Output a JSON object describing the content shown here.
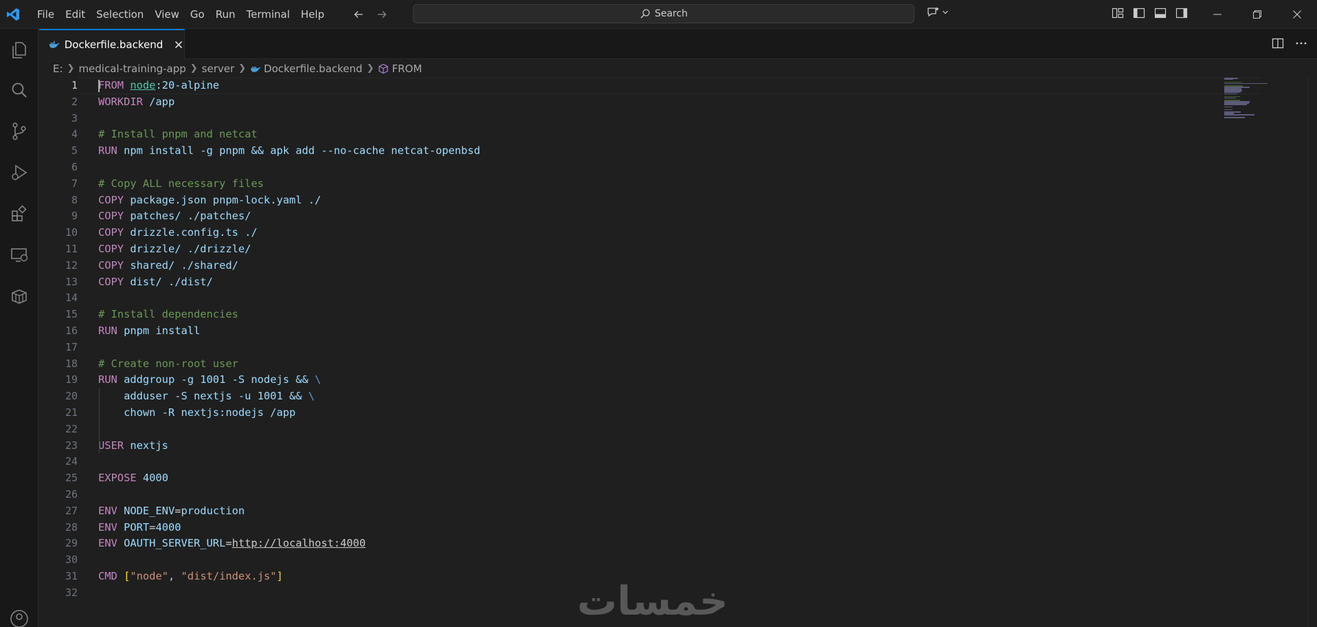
{
  "menu": [
    "File",
    "Edit",
    "Selection",
    "View",
    "Go",
    "Run",
    "Terminal",
    "Help"
  ],
  "search": {
    "label": "Search"
  },
  "tab": {
    "label": "Dockerfile.backend"
  },
  "breadcrumb": {
    "drive": "E:",
    "folder1": "medical-training-app",
    "folder2": "server",
    "file": "Dockerfile.backend",
    "symbol": "FROM"
  },
  "editor": {
    "active_line": 1,
    "line_numbers": [
      "1",
      "2",
      "3",
      "4",
      "5",
      "6",
      "7",
      "8",
      "9",
      "10",
      "11",
      "12",
      "13",
      "14",
      "15",
      "16",
      "17",
      "18",
      "19",
      "20",
      "21",
      "22",
      "23",
      "24",
      "25",
      "26",
      "27",
      "28",
      "29",
      "30",
      "31",
      "32"
    ],
    "lines": [
      [
        {
          "t": "FROM",
          "c": "kw"
        },
        {
          "t": " ",
          "c": "plain"
        },
        {
          "t": "node",
          "c": "type"
        },
        {
          "t": ":20-alpine",
          "c": "var"
        }
      ],
      [
        {
          "t": "WORKDIR",
          "c": "kw"
        },
        {
          "t": " /app",
          "c": "var"
        }
      ],
      [],
      [
        {
          "t": "# Install pnpm and netcat",
          "c": "cmt"
        }
      ],
      [
        {
          "t": "RUN",
          "c": "kw"
        },
        {
          "t": " npm install -g pnpm && apk add --no-cache netcat-openbsd",
          "c": "var"
        }
      ],
      [],
      [
        {
          "t": "# Copy ALL necessary files",
          "c": "cmt"
        }
      ],
      [
        {
          "t": "COPY",
          "c": "kw"
        },
        {
          "t": " package.json pnpm-lock.yaml ./",
          "c": "var"
        }
      ],
      [
        {
          "t": "COPY",
          "c": "kw"
        },
        {
          "t": " patches/ ./patches/",
          "c": "var"
        }
      ],
      [
        {
          "t": "COPY",
          "c": "kw"
        },
        {
          "t": " drizzle.config.ts ./",
          "c": "var"
        }
      ],
      [
        {
          "t": "COPY",
          "c": "kw"
        },
        {
          "t": " drizzle/ ./drizzle/",
          "c": "var"
        }
      ],
      [
        {
          "t": "COPY",
          "c": "kw"
        },
        {
          "t": " shared/ ./shared/",
          "c": "var"
        }
      ],
      [
        {
          "t": "COPY",
          "c": "kw"
        },
        {
          "t": " dist/ ./dist/",
          "c": "var"
        }
      ],
      [],
      [
        {
          "t": "# Install dependencies",
          "c": "cmt"
        }
      ],
      [
        {
          "t": "RUN",
          "c": "kw"
        },
        {
          "t": " pnpm install",
          "c": "var"
        }
      ],
      [],
      [
        {
          "t": "# Create non-root user",
          "c": "cmt"
        }
      ],
      [
        {
          "t": "RUN",
          "c": "kw"
        },
        {
          "t": " addgroup -g 1001 -S nodejs && ",
          "c": "var"
        },
        {
          "t": "\\",
          "c": "esc"
        }
      ],
      [
        {
          "t": "    adduser -S nextjs -u 1001 && ",
          "c": "var"
        },
        {
          "t": "\\",
          "c": "esc"
        }
      ],
      [
        {
          "t": "    chown -R nextjs:nodejs /app",
          "c": "var"
        }
      ],
      [],
      [
        {
          "t": "USER",
          "c": "kw"
        },
        {
          "t": " nextjs",
          "c": "var"
        }
      ],
      [],
      [
        {
          "t": "EXPOSE",
          "c": "kw"
        },
        {
          "t": " ",
          "c": "plain"
        },
        {
          "t": "4000",
          "c": "var"
        }
      ],
      [],
      [
        {
          "t": "ENV",
          "c": "kw"
        },
        {
          "t": " NODE_ENV",
          "c": "var"
        },
        {
          "t": "=",
          "c": "op"
        },
        {
          "t": "production",
          "c": "var"
        }
      ],
      [
        {
          "t": "ENV",
          "c": "kw"
        },
        {
          "t": " PORT",
          "c": "var"
        },
        {
          "t": "=",
          "c": "op"
        },
        {
          "t": "4000",
          "c": "var"
        }
      ],
      [
        {
          "t": "ENV",
          "c": "kw"
        },
        {
          "t": " OAUTH_SERVER_URL",
          "c": "var"
        },
        {
          "t": "=",
          "c": "op"
        },
        {
          "t": "http://localhost:4000",
          "c": "link"
        }
      ],
      [],
      [
        {
          "t": "CMD",
          "c": "kw"
        },
        {
          "t": " ",
          "c": "plain"
        },
        {
          "t": "[",
          "c": "bracket"
        },
        {
          "t": "\"node\"",
          "c": "str"
        },
        {
          "t": ", ",
          "c": "plain"
        },
        {
          "t": "\"dist/index.js\"",
          "c": "str"
        },
        {
          "t": "]",
          "c": "bracket"
        }
      ],
      []
    ]
  },
  "watermark": "خمسات",
  "colors": {
    "accent": "#0078d4",
    "background": "#1f1f1f",
    "activitybar": "#181818"
  }
}
